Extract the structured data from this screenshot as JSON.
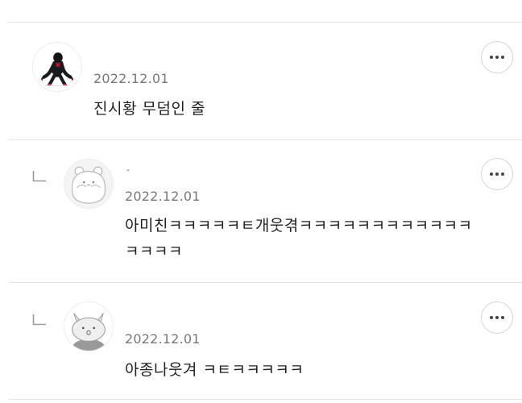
{
  "comments": [
    {
      "type": "comment",
      "avatar": "spider-man-avatar",
      "nickname": "",
      "date": "2022.12.01",
      "text": "진시황 무덤인 줄"
    },
    {
      "type": "reply",
      "avatar": "hamster-avatar",
      "nickname": "-",
      "date": "2022.12.01",
      "text_line1": "아미친ㅋㅋㅋㅋㅋㅌ개웃겪ㅋㅋㅋㅋㅋㅋㅋㅋㅋㅋㅋㅋ",
      "text_line2": "ㅋㅋㅋㅋ"
    },
    {
      "type": "reply",
      "avatar": "cat-avatar",
      "nickname": "",
      "date": "2022.12.01",
      "text": "아종나웃겨 ㅋㅌㅋㅋㅋㅋㅋ"
    }
  ],
  "icons": {
    "more": "more-options-icon",
    "reply": "reply-arrow-icon"
  }
}
